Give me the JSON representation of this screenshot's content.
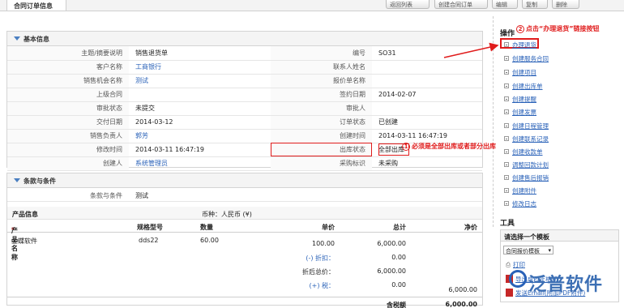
{
  "top": {
    "tab_title": "合同订单信息",
    "buttons": [
      "返回列表",
      "创建合同订单",
      "编辑",
      "复制",
      "删除"
    ]
  },
  "basic": {
    "title": "基本信息",
    "rows": [
      {
        "l1": "主题/摘要说明",
        "v1": "销售退货单",
        "l2": "编号",
        "v2": "SO31"
      },
      {
        "l1": "客户名称",
        "v1": "工商银行",
        "l2": "联系人姓名",
        "v2": ""
      },
      {
        "l1": "销售机会名称",
        "v1": "测试",
        "l2": "报价单名称",
        "v2": ""
      },
      {
        "l1": "上级合同",
        "v1": "",
        "l2": "签约日期",
        "v2": "2014-02-07"
      },
      {
        "l1": "审批状态",
        "v1": "未提交",
        "l2": "审批人",
        "v2": ""
      },
      {
        "l1": "交付日期",
        "v1": "2014-03-12",
        "l2": "订单状态",
        "v2": "已创建"
      },
      {
        "l1": "销售负责人",
        "v1": "郭芳",
        "l2": "创建时间",
        "v2": "2014-03-11 16:47:19"
      },
      {
        "l1": "修改时间",
        "v1": "2014-03-11 16:47:19",
        "l2": "出库状态",
        "v2": "全部出库"
      },
      {
        "l1": "创建人",
        "v1": "系统管理员",
        "l2": "采购标识",
        "v2": "未采购"
      }
    ]
  },
  "terms": {
    "title": "条款与条件",
    "label": "条款与条件",
    "value": "测试"
  },
  "products": {
    "info_label": "产品信息",
    "currency": "币种：人民币 (¥)",
    "headers": {
      "name": "产品名称",
      "spec": "规格型号",
      "qty": "数量",
      "price": "单价",
      "total": "总计",
      "net": "净价"
    },
    "row": {
      "name": "金蝶软件",
      "spec": "dds22",
      "qty": "60.00",
      "price": "100.00",
      "total": "6,000.00",
      "net": "6,000.00"
    },
    "discount_label": "(-) 折扣：",
    "discount_value": "0.00",
    "after_discount_label": "折后总价：",
    "after_discount_value": "6,000.00",
    "tax_label": "(+) 税：",
    "tax_value": "0.00",
    "tax_total_label": "含税额",
    "tax_total_value": "6,000.00"
  },
  "sidebar": {
    "ops_title": "操作",
    "items": [
      "办理退货",
      "创建服务合同",
      "创建项目",
      "创建出库单",
      "创建提醒",
      "创建发票",
      "创建日程管理",
      "创建联系记录",
      "创建收款单",
      "调整回款计划",
      "创建售后报销",
      "创建附件",
      "修改日志"
    ],
    "tools_title": "工具",
    "template_label": "请选择一个模板",
    "template_value": "合同报价模板",
    "print": "打印",
    "export_pdf": "导出成PDF格式",
    "send_email": "发送Email(附加PDF附件)"
  },
  "annotations": {
    "a1_num": "1",
    "a1_text": "必须是全部出库或者部分出库",
    "a2_num": "2",
    "a2_text": "点击“办理退货”链接按钮"
  },
  "watermark": "泛普软件",
  "colors": {
    "accent": "#2a62b8",
    "annotation": "#e01c1c"
  }
}
